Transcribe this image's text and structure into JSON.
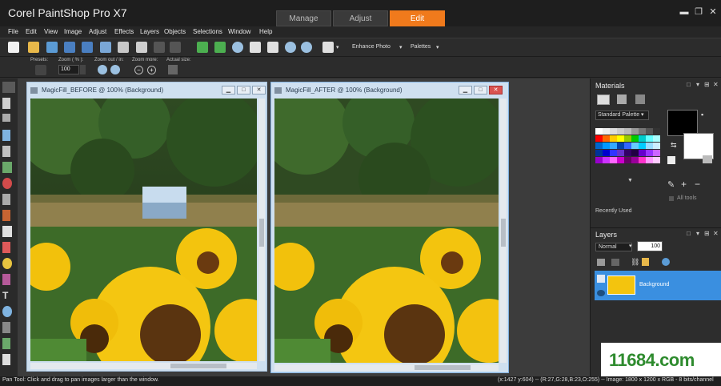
{
  "app": {
    "title": "Corel PaintShop Pro X7"
  },
  "workspace_tabs": [
    "Manage",
    "Adjust",
    "Edit"
  ],
  "active_tab": "Edit",
  "window_controls": {
    "minimize": "▬",
    "restore": "❐",
    "close": "✕"
  },
  "menu": [
    "File",
    "Edit",
    "View",
    "Image",
    "Adjust",
    "Effects",
    "Layers",
    "Objects",
    "Selections",
    "Window",
    "Help"
  ],
  "toolbar": {
    "enhance_photo": "Enhance Photo",
    "palettes": "Palettes",
    "dropdown_arrow": "▾"
  },
  "tool_options": {
    "presets_label": "Presets:",
    "zoom_label": "Zoom ( % ):",
    "zoom_value": "100",
    "zoom_inout_label": "Zoom out / in:",
    "zoom_more_label": "Zoom more:",
    "actual_size_label": "Actual size:"
  },
  "documents": [
    {
      "title": "MagicFill_BEFORE @ 100% (Background)"
    },
    {
      "title": "MagicFill_AFTER @ 100% (Background)"
    }
  ],
  "materials": {
    "title": "Materials",
    "palette_select": "Standard Palette",
    "all_tools_label": "All tools",
    "recently_used_label": "Recently Used",
    "swatch_colors": [
      "#ffffff",
      "#eeeeee",
      "#dddddd",
      "#cccccc",
      "#bbbbbb",
      "#999999",
      "#777777",
      "#555555",
      "#333333",
      "#ff0000",
      "#ff6600",
      "#ffcc00",
      "#ffff00",
      "#99cc00",
      "#00cc00",
      "#00cccc",
      "#66ffff",
      "#aaffff",
      "#0066cc",
      "#0099ff",
      "#33aaff",
      "#0044aa",
      "#3366ff",
      "#66ccff",
      "#00ccff",
      "#99ddff",
      "#cceeff",
      "#003399",
      "#0000cc",
      "#3333ff",
      "#6633cc",
      "#330066",
      "#220044",
      "#6600cc",
      "#9933ff",
      "#cc66ff",
      "#9900cc",
      "#cc33ff",
      "#ff66ff",
      "#cc00cc",
      "#660066",
      "#990099",
      "#ff33cc",
      "#ff99ff",
      "#ffccff"
    ],
    "foreground_color": "#000000",
    "background_color": "#ffffff"
  },
  "layers": {
    "title": "Layers",
    "blend_mode": "Normal",
    "opacity": "100",
    "layer_name": "Background"
  },
  "status": {
    "hint": "Pan Tool: Click and drag to pan images larger than the window.",
    "coords": "(x:1427 y:604) -- (R:27,G:28,B:23,O:255) -- Image: 1800 x 1200 x RGB - 8 bits/channel"
  },
  "watermark": "11684.com"
}
